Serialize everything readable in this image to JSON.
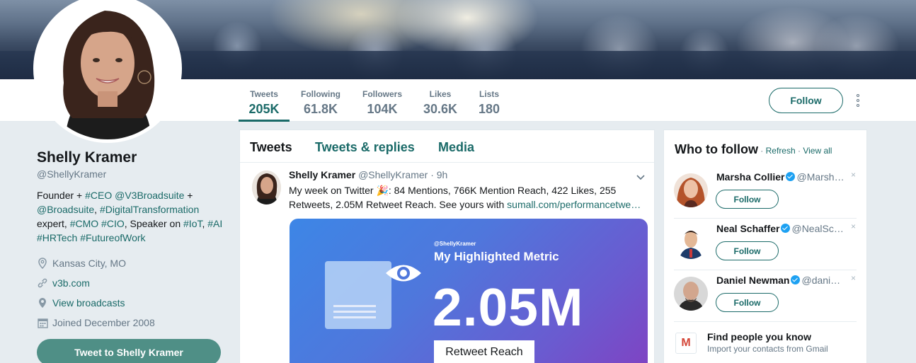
{
  "profile": {
    "name": "Shelly Kramer",
    "handle": "@ShellyKramer",
    "bio": {
      "p1": "Founder + ",
      "t1": "#CEO",
      "p2": " ",
      "t2": "@V3Broadsuite",
      "p3": " +",
      "t3": "@Broadsuite",
      "p4": ", ",
      "t4": "#DigitalTransformation",
      "p5": "expert, ",
      "t5": "#CMO",
      "p6": " ",
      "t6": "#CIO",
      "p7": ", Speaker on ",
      "t7": "#IoT",
      "p8": ", ",
      "t8": "#AI",
      "t9": "#HRTech",
      "p9": " ",
      "t10": "#FutureofWork"
    },
    "location": "Kansas City, MO",
    "website": "v3b.com",
    "broadcasts": "View broadcasts",
    "joined": "Joined December 2008",
    "tweet_to_label": "Tweet to Shelly Kramer"
  },
  "stats": [
    {
      "label": "Tweets",
      "value": "205K"
    },
    {
      "label": "Following",
      "value": "61.8K"
    },
    {
      "label": "Followers",
      "value": "104K"
    },
    {
      "label": "Likes",
      "value": "30.6K"
    },
    {
      "label": "Lists",
      "value": "180"
    }
  ],
  "follow_label": "Follow",
  "tabs": [
    "Tweets",
    "Tweets & replies",
    "Media"
  ],
  "tweet": {
    "name": "Shelly Kramer",
    "handle": "@ShellyKramer",
    "time": "· 9h",
    "text1": "My week on Twitter 🎉: 84 Mentions, 766K Mention Reach, 422 Likes, 255",
    "text2": "Retweets, 2.05M Retweet Reach. See yours with ",
    "link": "sumall.com/performancetwe…",
    "card": {
      "tag": "@ShellyKramer",
      "title": "My Highlighted Metric",
      "big": "2.05M",
      "pill": "Retweet Reach"
    }
  },
  "who_to_follow": {
    "title": "Who to follow",
    "sep1": " · ",
    "refresh": "Refresh",
    "sep2": " · ",
    "view_all": "View all",
    "close": "×",
    "follow_label": "Follow",
    "suggestions": [
      {
        "name": "Marsha Collier",
        "handle": "@Marsh…"
      },
      {
        "name": "Neal Schaffer",
        "handle": "@NealSc…"
      },
      {
        "name": "Daniel Newman",
        "handle": "@dani…"
      }
    ],
    "find": {
      "icon": "M",
      "title": "Find people you know",
      "subtitle": "Import your contacts from Gmail"
    }
  },
  "colors": {
    "accent": "#1a6a68",
    "tweet_to_button": "#4f8f86",
    "card_start": "#3d86e6",
    "card_end": "#8042c2"
  }
}
